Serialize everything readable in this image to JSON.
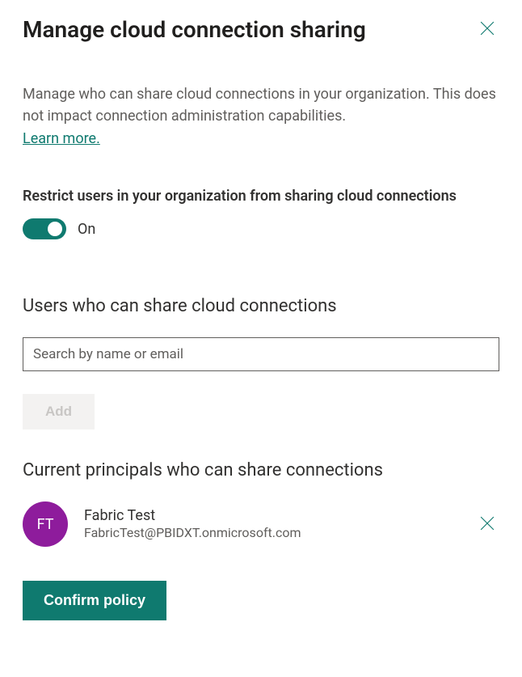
{
  "header": {
    "title": "Manage cloud connection sharing"
  },
  "description": "Manage who can share cloud connections in your organization. This does not impact connection administration capabilities.",
  "learn_more_label": "Learn more.",
  "restrict": {
    "label": "Restrict users in your organization from sharing cloud connections",
    "state": "On"
  },
  "users_section": {
    "heading": "Users who can share cloud connections",
    "search_placeholder": "Search by name or email",
    "add_label": "Add"
  },
  "principals_section": {
    "heading": "Current principals who can share connections",
    "items": [
      {
        "initials": "FT",
        "name": "Fabric Test",
        "email": "FabricTest@PBIDXT.onmicrosoft.com"
      }
    ]
  },
  "confirm_label": "Confirm policy"
}
